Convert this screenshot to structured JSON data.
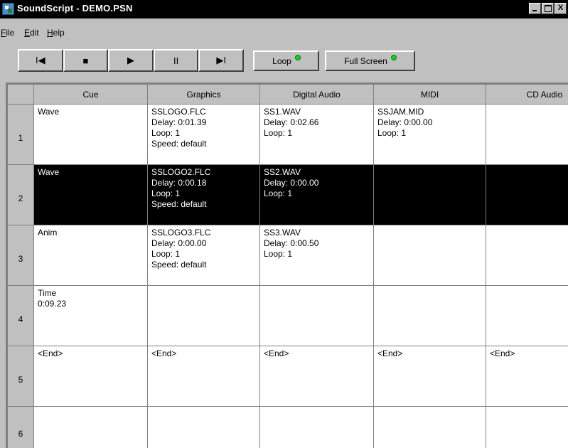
{
  "window": {
    "title": "SoundScript - DEMO.PSN",
    "buttons": {
      "minimize_icon": "minimize-icon",
      "maximize_icon": "maximize-icon",
      "close_label": "X"
    }
  },
  "menu": [
    {
      "accel": "F",
      "rest": "ile"
    },
    {
      "accel": "E",
      "rest": "dit"
    },
    {
      "accel": "H",
      "rest": "elp"
    }
  ],
  "toolbar": {
    "transport": [
      {
        "label": "I◀",
        "icon": "skip-to-start-icon"
      },
      {
        "label": "■",
        "icon": "stop-icon"
      },
      {
        "label": "▶",
        "icon": "play-icon"
      },
      {
        "label": "II",
        "icon": "pause-icon"
      },
      {
        "label": "▶I",
        "icon": "skip-to-end-icon"
      }
    ],
    "loop_label": "Loop",
    "fullscreen_label": "Full Screen",
    "indicator_color": "#16d016"
  },
  "grid": {
    "columns": [
      "Cue",
      "Graphics",
      "Digital Audio",
      "MIDI",
      "CD Audio"
    ],
    "rows": [
      {
        "num": "1",
        "cue": [
          "Wave"
        ],
        "graphics": [
          "SSLOGO.FLC",
          "Delay: 0:01.39",
          "Loop: 1",
          "Speed: default"
        ],
        "digital": [
          "SS1.WAV",
          "Delay: 0:02.66",
          "Loop: 1"
        ],
        "midi": [
          "SSJAM.MID",
          "Delay: 0:00.00",
          "Loop: 1"
        ],
        "cd": []
      },
      {
        "num": "2",
        "cue": [
          "Wave"
        ],
        "graphics": [
          "SSLOGO2.FLC",
          "Delay: 0:00.18",
          "Loop: 1",
          "Speed: default"
        ],
        "digital": [
          "SS2.WAV",
          "Delay: 0:00.00",
          "Loop: 1"
        ],
        "midi": [],
        "cd": []
      },
      {
        "num": "3",
        "cue": [
          "Anim"
        ],
        "graphics": [
          "SSLOGO3.FLC",
          "Delay: 0:00.00",
          "Loop: 1",
          "Speed: default"
        ],
        "digital": [
          "SS3.WAV",
          "Delay: 0:00.50",
          "Loop: 1"
        ],
        "midi": [],
        "cd": []
      },
      {
        "num": "4",
        "cue": [
          "Time",
          "0:09.23"
        ],
        "graphics": [],
        "digital": [],
        "midi": [],
        "cd": []
      },
      {
        "num": "5",
        "cue": [
          "<End>"
        ],
        "graphics": [
          "<End>"
        ],
        "digital": [
          "<End>"
        ],
        "midi": [
          "<End>"
        ],
        "cd": [
          "<End>"
        ]
      },
      {
        "num": "6",
        "cue": [],
        "graphics": [],
        "digital": [],
        "midi": [],
        "cd": []
      }
    ],
    "selected_row": "2"
  }
}
